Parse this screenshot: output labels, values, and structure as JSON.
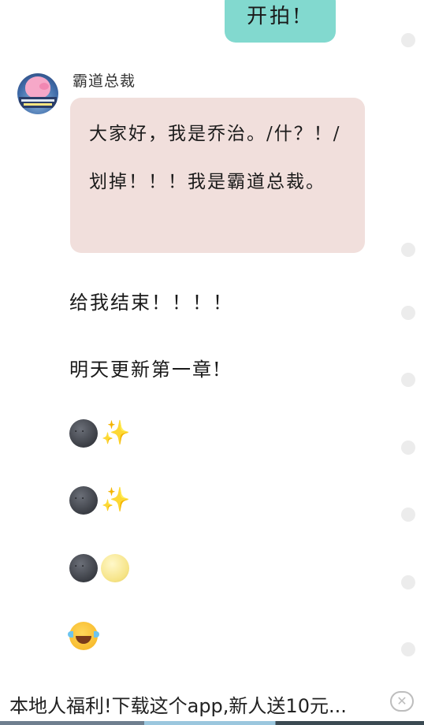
{
  "top_bubble": {
    "text": "开拍!"
  },
  "sender": {
    "name": "霸道总裁",
    "avatar_icon": "peppa-pig-avatar"
  },
  "main_bubble": {
    "text": "大家好，我是乔治。/什？！/划掉！！！我是霸道总裁。"
  },
  "messages": [
    {
      "text": "给我结束！！！！"
    },
    {
      "text": "明天更新第一章!"
    }
  ],
  "emoji_rows": [
    {
      "icons": [
        "new-moon-face-icon",
        "sparkles-icon"
      ]
    },
    {
      "icons": [
        "new-moon-face-icon",
        "sparkles-icon"
      ]
    },
    {
      "icons": [
        "new-moon-face-icon",
        "full-moon-face-icon"
      ]
    },
    {
      "icons": [
        "face-with-tears-of-joy-icon"
      ]
    }
  ],
  "ad_banner": {
    "text": "本地人福利!下载这个app,新人送10元...",
    "close_icon": "close-icon"
  },
  "colors": {
    "top_bubble_bg": "#82d9cf",
    "main_bubble_bg": "#f1dfdc",
    "side_dot": "#ececec"
  }
}
